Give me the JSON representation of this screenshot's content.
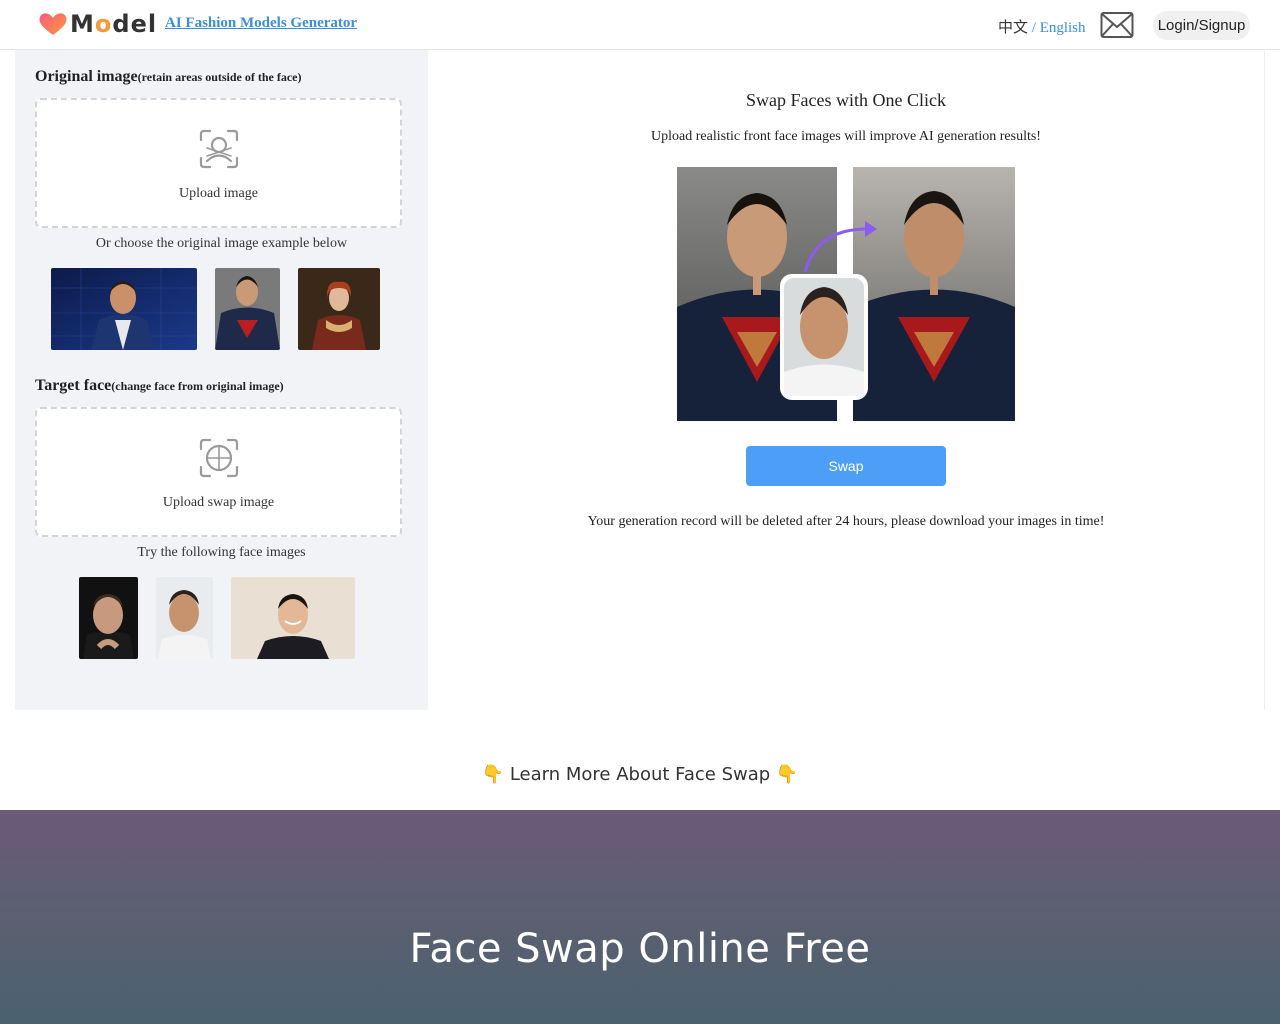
{
  "header": {
    "logo_text_prefix": "M",
    "logo_text_o": "o",
    "logo_text_suffix": "del",
    "brand_link": "AI Fashion Models Generator",
    "lang_zh": "中文",
    "lang_sep": "/",
    "lang_en": "English",
    "login_label": "Login/Signup"
  },
  "left": {
    "original": {
      "title": "Original image",
      "subtitle": "(retain areas outside of the face)",
      "upload_label": "Upload image",
      "hint": "Or choose the original image example below"
    },
    "target": {
      "title": "Target face",
      "subtitle": "(change face from original image)",
      "upload_label": "Upload swap image",
      "hint": "Try the following face images"
    }
  },
  "right": {
    "title": "Swap Faces with One Click",
    "subtitle": "Upload realistic front face images will improve AI generation results!",
    "swap_label": "Swap",
    "note": "Your generation record will be deleted after 24 hours, please download your images in time!"
  },
  "learn_more": {
    "emoji": "👇",
    "text": "Learn More About Face Swap"
  },
  "banner": {
    "title": "Face Swap Online Free"
  },
  "colors": {
    "accent": "#4d9ef7",
    "link": "#3a8fd8",
    "panel_bg": "#f2f3f6"
  }
}
